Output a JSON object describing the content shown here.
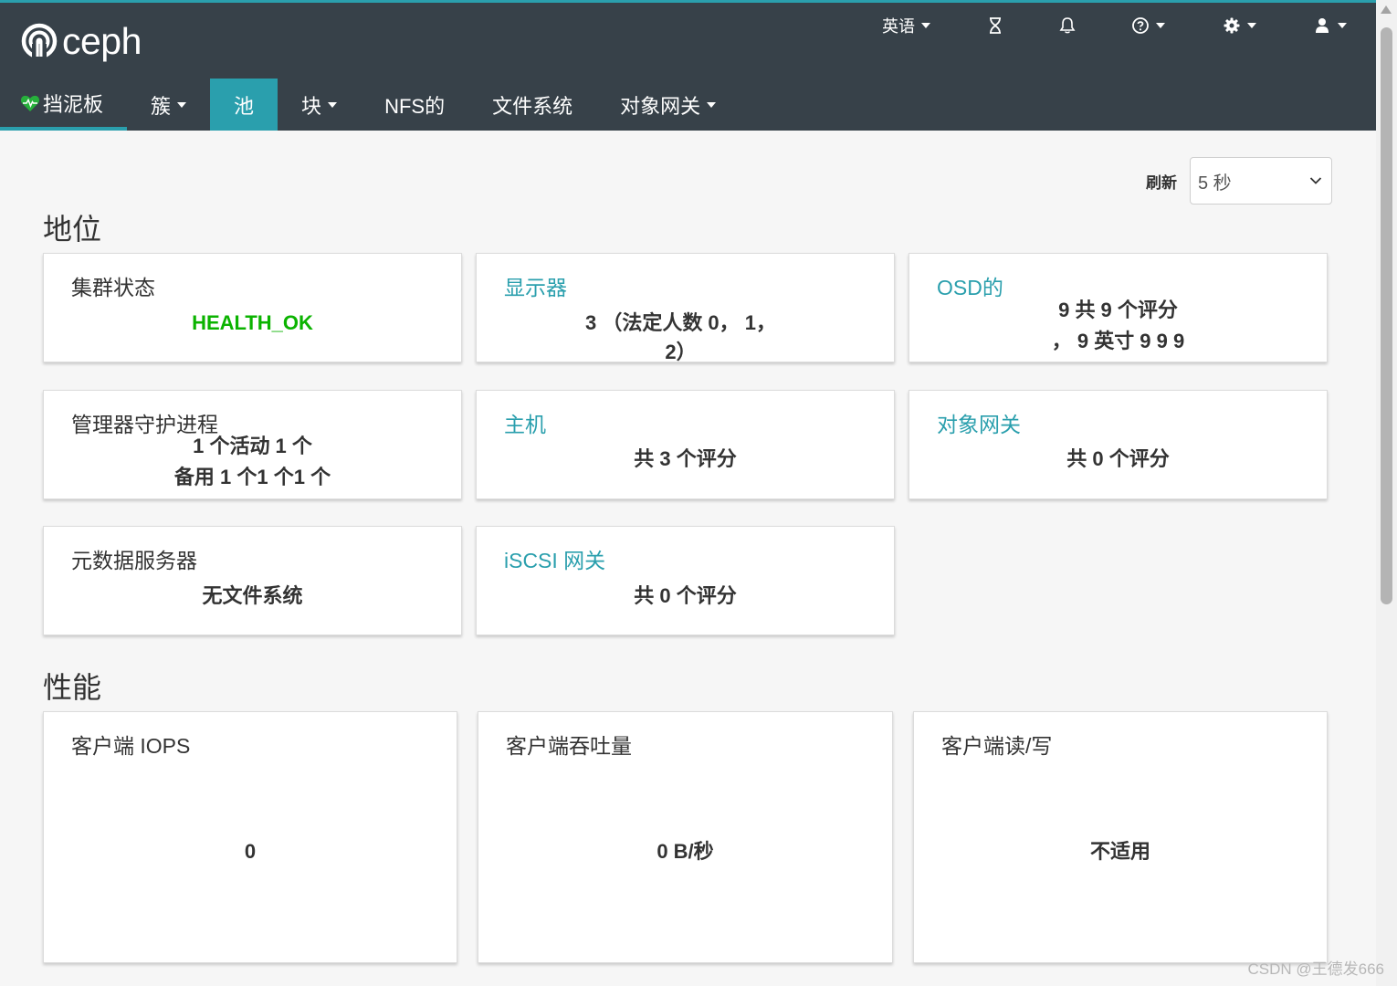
{
  "navbar": {
    "logo_text": "ceph",
    "language_label": "英语",
    "tabs": [
      {
        "label": "挡泥板"
      },
      {
        "label": "簇"
      },
      {
        "label": "池"
      },
      {
        "label": "块"
      },
      {
        "label": "NFS的"
      },
      {
        "label": "文件系统"
      },
      {
        "label": "对象网关"
      }
    ]
  },
  "refresh": {
    "label": "刷新",
    "selected": "5 秒"
  },
  "status_section": {
    "title": "地位",
    "cards": {
      "cluster_status": {
        "title": "集群状态",
        "value": "HEALTH_OK"
      },
      "monitors": {
        "title": "显示器",
        "value_line1": "3 （法定人数 0， 1，",
        "value_line2": "2）"
      },
      "osds": {
        "title": "OSD的",
        "value_line1": "9 共 9 个评分",
        "value_line2": "，  9 英寸 9 9 9"
      },
      "manager_daemons": {
        "title": "管理器守护进程",
        "value_line1": "1 个活动 1 个",
        "value_line2": "备用 1 个1 个1 个"
      },
      "hosts": {
        "title": "主机",
        "value": "共 3 个评分"
      },
      "object_gateways": {
        "title": "对象网关",
        "value": "共 0 个评分"
      },
      "metadata_servers": {
        "title": "元数据服务器",
        "value": "无文件系统"
      },
      "iscsi_gateways": {
        "title": "iSCSI 网关",
        "value": "共 0 个评分"
      }
    }
  },
  "performance_section": {
    "title": "性能",
    "cards": {
      "client_iops": {
        "title": "客户端 IOPS",
        "value": "0"
      },
      "client_throughput": {
        "title": "客户端吞吐量",
        "value": "0 B/秒"
      },
      "client_read_write": {
        "title": "客户端读/写",
        "value": "不适用"
      }
    }
  },
  "watermark": "CSDN @王德发666",
  "colors": {
    "navbar": "#374149",
    "accent": "#2a9fad",
    "health_ok": "#0bb300"
  }
}
